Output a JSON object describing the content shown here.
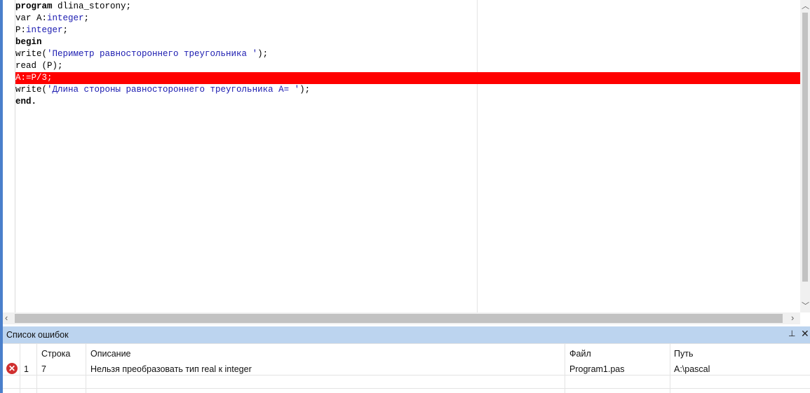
{
  "editor": {
    "lines": [
      [
        {
          "t": "program",
          "c": "kw"
        },
        {
          "t": " dlina_storony;",
          "c": ""
        }
      ],
      [
        {
          "t": "var A:",
          "c": ""
        },
        {
          "t": "integer",
          "c": "blue"
        },
        {
          "t": ";",
          "c": ""
        }
      ],
      [
        {
          "t": "P:",
          "c": ""
        },
        {
          "t": "integer",
          "c": "blue"
        },
        {
          "t": ";",
          "c": ""
        }
      ],
      [
        {
          "t": "begin",
          "c": "kw"
        }
      ],
      [
        {
          "t": "write(",
          "c": ""
        },
        {
          "t": "'Периметр равностороннего треугольника '",
          "c": "blue"
        },
        {
          "t": ");",
          "c": ""
        }
      ],
      [
        {
          "t": "read (P);",
          "c": ""
        }
      ],
      [
        {
          "t": "A:=P/3;",
          "c": ""
        }
      ],
      [
        {
          "t": "write(",
          "c": ""
        },
        {
          "t": "'Длина стороны равностороннего треугольника A= '",
          "c": "blue"
        },
        {
          "t": ");",
          "c": ""
        }
      ],
      [
        {
          "t": "end.",
          "c": "kw"
        }
      ]
    ],
    "error_line_index": 6,
    "error_color": "#ff0000"
  },
  "error_panel": {
    "title": "Список ошибок",
    "pin_icon": "pin-icon",
    "close_icon": "close-icon",
    "columns": {
      "num": "",
      "line": "Строка",
      "description": "Описание",
      "file": "Файл",
      "path": "Путь"
    },
    "rows": [
      {
        "icon": "error-icon",
        "num": "1",
        "line": "7",
        "description": "Нельзя преобразовать тип real к integer",
        "file": "Program1.pas",
        "path": "A:\\pascal"
      }
    ]
  }
}
